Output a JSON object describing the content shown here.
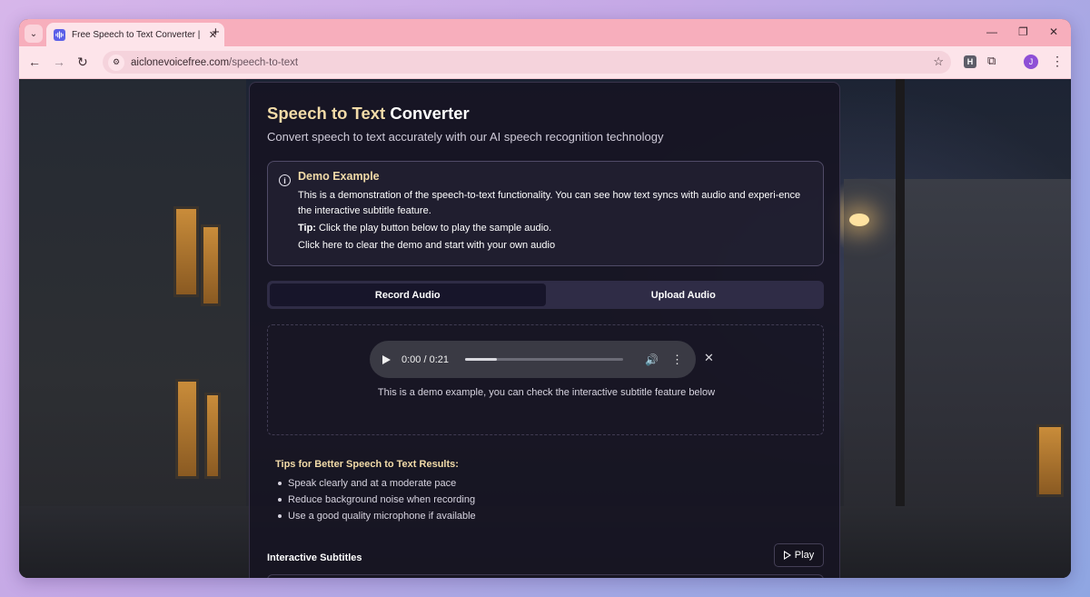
{
  "browser": {
    "tab_title": "Free Speech to Text Converter |",
    "tab_close_icon": "close-icon",
    "new_tab_icon": "plus-icon",
    "url_domain": "aiclonevoicefree.com",
    "url_path": "/speech-to-text",
    "profile_initial": "J",
    "extension_label": "H"
  },
  "page": {
    "title_accent": "Speech to Text",
    "title_rest": " Converter",
    "subtitle": "Convert speech to text accurately with our AI speech recognition technology",
    "demo": {
      "title": "Demo Example",
      "text": "This is a demonstration of the speech-to-text functionality. You can see how text syncs with audio and experi-ence the interactive subtitle feature.",
      "tip_label": "Tip:",
      "tip_text": " Click the play button below to play the sample audio.",
      "clear_text": "Click here to clear the demo and start with your own audio"
    },
    "tabs": {
      "record": "Record Audio",
      "upload": "Upload Audio",
      "active": "record"
    },
    "player": {
      "time": "0:00 / 0:21",
      "progress": 0.2,
      "caption": "This is a demo example, you can check the interactive subtitle feature below"
    },
    "tips": {
      "title": "Tips for Better Speech to Text Results:",
      "items": [
        "Speak clearly and at a moderate pace",
        "Reduce background noise when recording",
        "Use a good quality microphone if available"
      ]
    },
    "subtitles": {
      "label": "Interactive Subtitles",
      "play_label": "Play"
    }
  },
  "colors": {
    "accent": "#f2dba8",
    "tabstrip": "#f7aebc",
    "toolbar": "#fde4ea"
  }
}
